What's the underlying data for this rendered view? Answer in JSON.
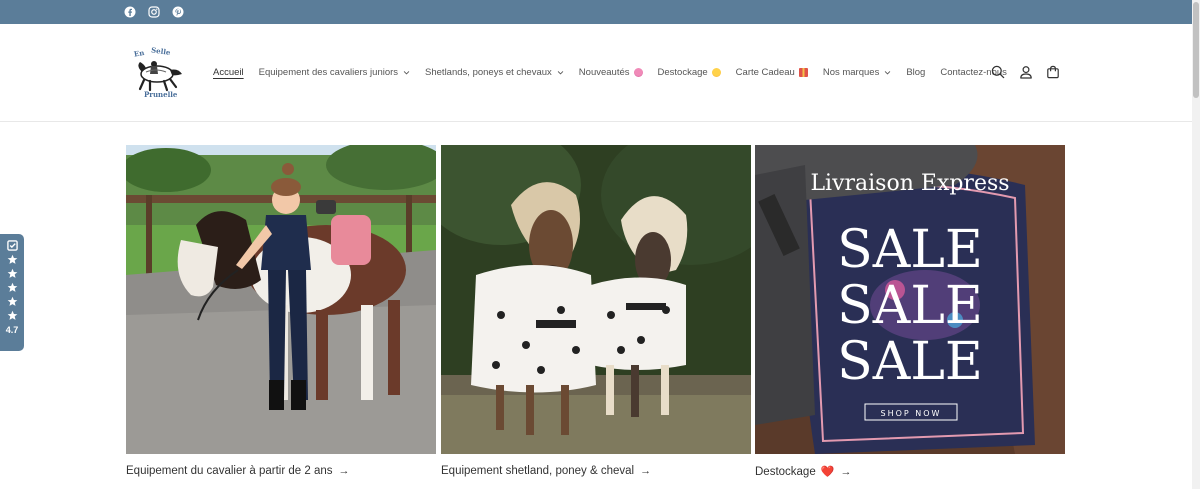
{
  "social": {
    "icons": [
      "facebook-icon",
      "instagram-icon",
      "pinterest-icon"
    ]
  },
  "header": {
    "logo_text_top": "En Selle",
    "logo_text_bottom": "Prunelle",
    "nav": [
      {
        "label": "Accueil",
        "active": true,
        "dropdown": false
      },
      {
        "label": "Equipement des cavaliers juniors",
        "active": false,
        "dropdown": true
      },
      {
        "label": "Shetlands, poneys et chevaux",
        "active": false,
        "dropdown": true
      },
      {
        "label": "Nouveautés",
        "active": false,
        "dropdown": false,
        "emoji": "🌷"
      },
      {
        "label": "Destockage",
        "active": false,
        "dropdown": false,
        "emoji": "😱"
      },
      {
        "label": "Carte Cadeau",
        "active": false,
        "dropdown": false,
        "emoji": "🎁"
      },
      {
        "label": "Nos marques",
        "active": false,
        "dropdown": true
      },
      {
        "label": "Blog",
        "active": false,
        "dropdown": false
      },
      {
        "label": "Contactez-nous",
        "active": false,
        "dropdown": false
      }
    ],
    "icons": [
      "search-icon",
      "account-icon",
      "cart-icon"
    ]
  },
  "cards": [
    {
      "label": "Equipement du cavalier à partir de 2 ans",
      "arrow": "→"
    },
    {
      "label": "Equipement shetland, poney & cheval",
      "arrow": "→"
    },
    {
      "label": "Destockage",
      "emoji": "❤️",
      "arrow": "→",
      "banner": {
        "title": "Livraison Express",
        "sale1": "SALE",
        "sale2": "SALE",
        "sale3": "SALE",
        "button": "SHOP NOW"
      }
    }
  ],
  "reviews": {
    "rating": "4.7"
  },
  "colors": {
    "topbar": "#5b7d99",
    "text": "#333333",
    "accent": "#5b7d99"
  }
}
